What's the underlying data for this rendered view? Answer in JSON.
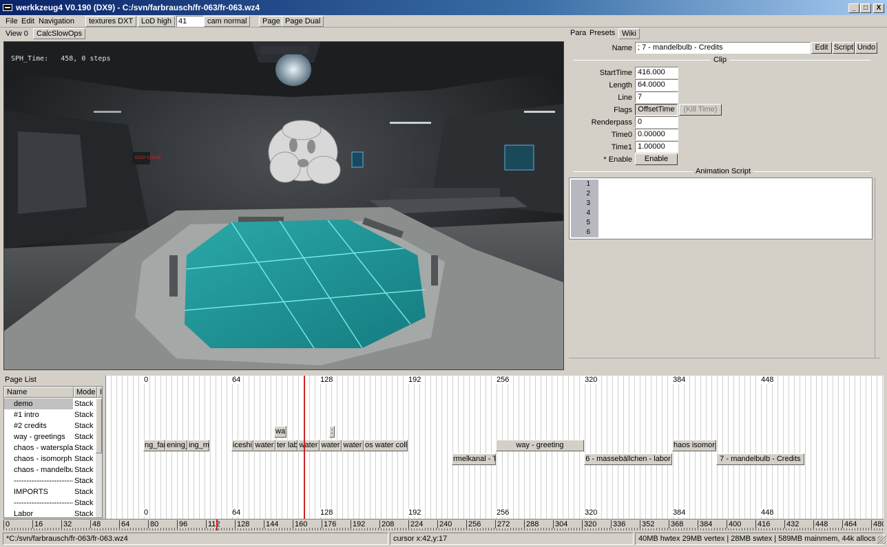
{
  "window": {
    "title": "werkkzeug4 V0.190 (DX9) - C:/svn/farbrausch/fr-063/fr-063.wz4",
    "minimize": "_",
    "maximize": "□",
    "close": "X"
  },
  "menu": [
    "File",
    "Edit",
    "Navigation"
  ],
  "toolbar": {
    "textures": "textures DXT",
    "lod": "LoD high",
    "fps_value": "41",
    "cam": "cam normal",
    "page": "Page",
    "page_dual": "Page Dual"
  },
  "view": {
    "tab": "View 0",
    "calc_button": "CalcSlowOps",
    "sph_time": "SPH_Time:   458, 0 steps",
    "sign_text": "KEEP CLEAR"
  },
  "panel_tabs": [
    "Para",
    "Presets",
    "Wiki"
  ],
  "para": {
    "name_label": "Name",
    "name_value": "; 7 - mandelbulb - Credits",
    "edit": "Edit",
    "script": "Script",
    "undo": "Undo",
    "clip_header": "Clip",
    "starttime_label": "StartTime",
    "starttime_value": "416.000",
    "length_label": "Length",
    "length_value": "64.0000",
    "line_label": "Line",
    "line_value": "7",
    "flags_label": "Flags",
    "flag_offset": "OffsetTime",
    "flag_kill": "(Kill Time)",
    "renderpass_label": "Renderpass",
    "renderpass_value": "0",
    "time0_label": "Time0",
    "time0_value": "0.00000",
    "time1_label": "Time1",
    "time1_value": "1.00000",
    "enable_label": "* Enable",
    "enable_button": "Enable",
    "anim_header": "Animation Script",
    "line_numbers": [
      "1",
      "2",
      "3",
      "4",
      "5",
      "6"
    ]
  },
  "pagelist": {
    "title": "Page List",
    "col_name": "Name",
    "col_mode": "Mode",
    "col_extra": "I",
    "rows": [
      {
        "name": "demo",
        "mode": "Stack"
      },
      {
        "name": "#1 intro",
        "mode": "Stack"
      },
      {
        "name": "#2 credits",
        "mode": "Stack"
      },
      {
        "name": "way - greetings",
        "mode": "Stack"
      },
      {
        "name": "chaos - watersplash",
        "mode": "Stack"
      },
      {
        "name": "chaos - isomorph",
        "mode": "Stack"
      },
      {
        "name": "chaos - mandelbulb",
        "mode": "Stack"
      },
      {
        "name": "------------------------",
        "mode": "Stack"
      },
      {
        "name": "IMPORTS",
        "mode": "Stack"
      },
      {
        "name": "------------------------",
        "mode": "Stack"
      },
      {
        "name": "Labor",
        "mode": "Stack"
      }
    ]
  },
  "timeline": {
    "top_labels": [
      "0",
      "64",
      "128",
      "192",
      "256",
      "320",
      "384",
      "448"
    ],
    "bottom_labels": [
      "0",
      "64",
      "128",
      "192",
      "256",
      "320",
      "384",
      "448"
    ],
    "clips": [
      "wa",
      ":",
      "ng_far",
      "ening_",
      "ing_m",
      "iceshi",
      "water",
      "ter lab",
      "water",
      "water",
      "water",
      "os water coll",
      "way - greeting",
      "haos isomorp",
      "rmelkanal - T",
      "6 - massebällchen - labor",
      "7 - mandelbulb - Credits"
    ]
  },
  "ruler": [
    "0",
    "16",
    "32",
    "48",
    "64",
    "80",
    "96",
    "112",
    "128",
    "144",
    "160",
    "176",
    "192",
    "208",
    "224",
    "240",
    "256",
    "272",
    "288",
    "304",
    "320",
    "336",
    "352",
    "368",
    "384",
    "400",
    "416",
    "432",
    "448",
    "464",
    "480"
  ],
  "status": {
    "file": "*C:/svn/farbrausch/fr-063/fr-063.wz4",
    "cursor": "cursor x:42,y:17",
    "memory": "40MB hwtex  29MB vertex | 28MB swtex | 589MB mainmem, 44k allocs"
  }
}
